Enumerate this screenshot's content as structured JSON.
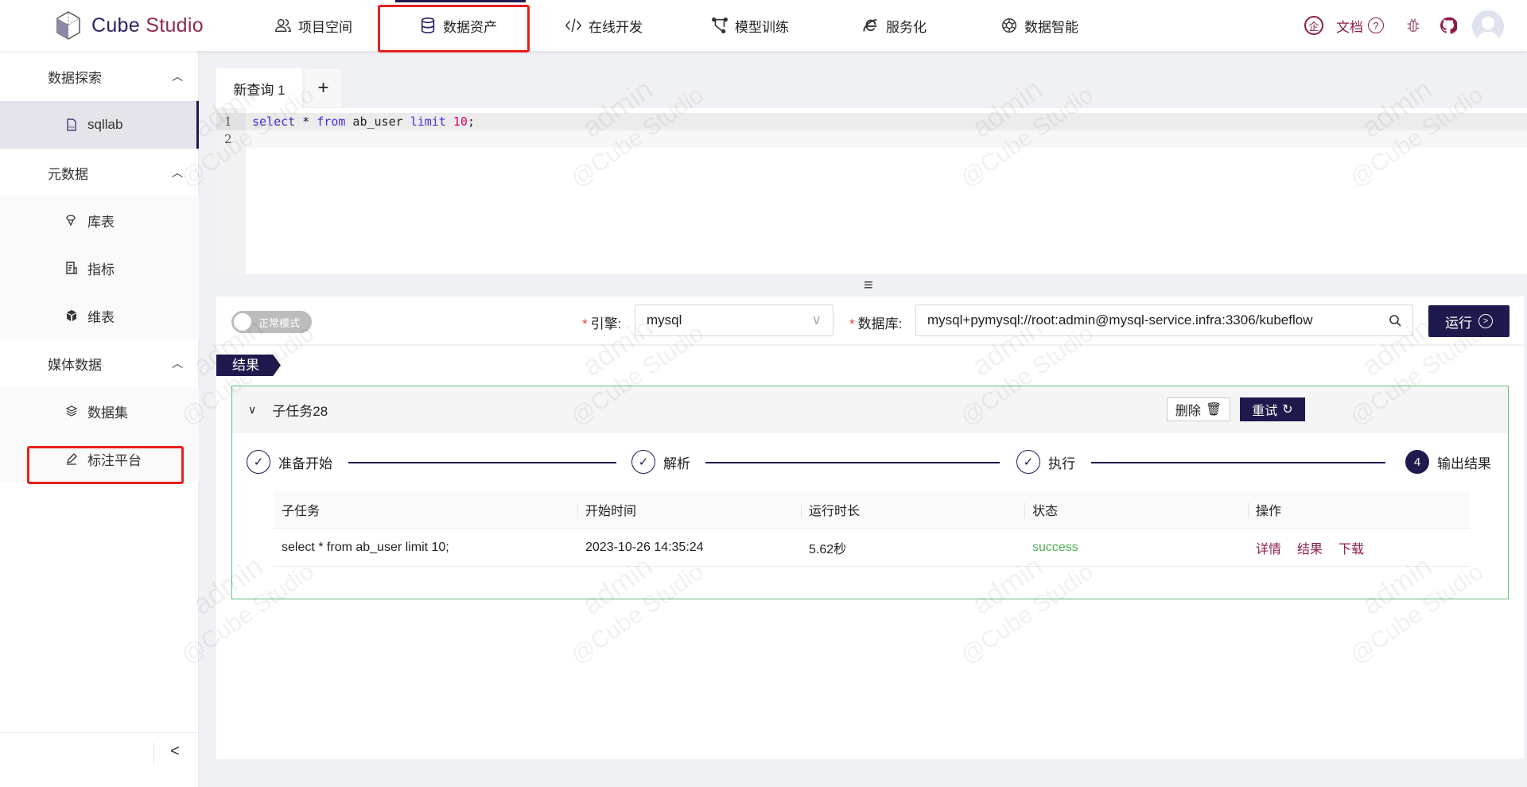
{
  "header": {
    "brand_a": "Cube ",
    "brand_b": "Studio",
    "nav": [
      {
        "label": "项目空间",
        "icon": "users-icon"
      },
      {
        "label": "数据资产",
        "icon": "database-icon"
      },
      {
        "label": "在线开发",
        "icon": "code-icon"
      },
      {
        "label": "模型训练",
        "icon": "model-icon"
      },
      {
        "label": "服务化",
        "icon": "ie-icon"
      },
      {
        "label": "数据智能",
        "icon": "openai-icon"
      }
    ],
    "enterprise": "企",
    "docs": "文档"
  },
  "sidebar": {
    "groups": [
      {
        "label": "数据探索",
        "items": [
          {
            "label": "sqllab",
            "icon": "sql-file-icon",
            "active": true
          }
        ]
      },
      {
        "label": "元数据",
        "items": [
          {
            "label": "库表",
            "icon": "table-icon"
          },
          {
            "label": "指标",
            "icon": "metric-icon"
          },
          {
            "label": "维表",
            "icon": "cube-icon"
          }
        ]
      },
      {
        "label": "媒体数据",
        "items": [
          {
            "label": "数据集",
            "icon": "layers-icon"
          },
          {
            "label": "标注平台",
            "icon": "pen-icon"
          }
        ]
      }
    ],
    "collapse": "<"
  },
  "query": {
    "tabs": [
      "新查询 1"
    ],
    "add_tab": "+",
    "lines": [
      "1",
      "2"
    ],
    "code": {
      "k1": "select",
      "t1": " * ",
      "k2": "from",
      "t2": " ab_user ",
      "k3": "limit",
      "t3": " ",
      "n": "10",
      "end": ";"
    },
    "resize": "≡"
  },
  "toolbar": {
    "mode": "正常模式",
    "engine_label": "引擎:",
    "engine_value": "mysql",
    "db_label": "数据库:",
    "db_value": "mysql+pymysql://root:admin@mysql-service.infra:3306/kubeflow",
    "run": "运行"
  },
  "result": {
    "tag": "结果",
    "task_title": "子任务28",
    "delete": "删除",
    "retry": "重试",
    "steps": [
      {
        "label": "准备开始",
        "state": "done"
      },
      {
        "label": "解析",
        "state": "done"
      },
      {
        "label": "执行",
        "state": "done"
      },
      {
        "label": "输出结果",
        "state": "current",
        "num": "4"
      }
    ],
    "columns": [
      "子任务",
      "开始时间",
      "运行时长",
      "状态",
      "操作"
    ],
    "rows": [
      {
        "task": "select * from ab_user limit 10;",
        "start": "2023-10-26 14:35:24",
        "duration": "5.62秒",
        "status": "success",
        "actions": [
          "详情",
          "结果",
          "下载"
        ]
      }
    ]
  },
  "watermark": {
    "user": "admin",
    "brand": "@Cube Studio"
  },
  "colors": {
    "primary": "#1e1a4d",
    "accent": "#8b1e4a",
    "success": "#4caf50",
    "highlight": "#e8201b"
  }
}
